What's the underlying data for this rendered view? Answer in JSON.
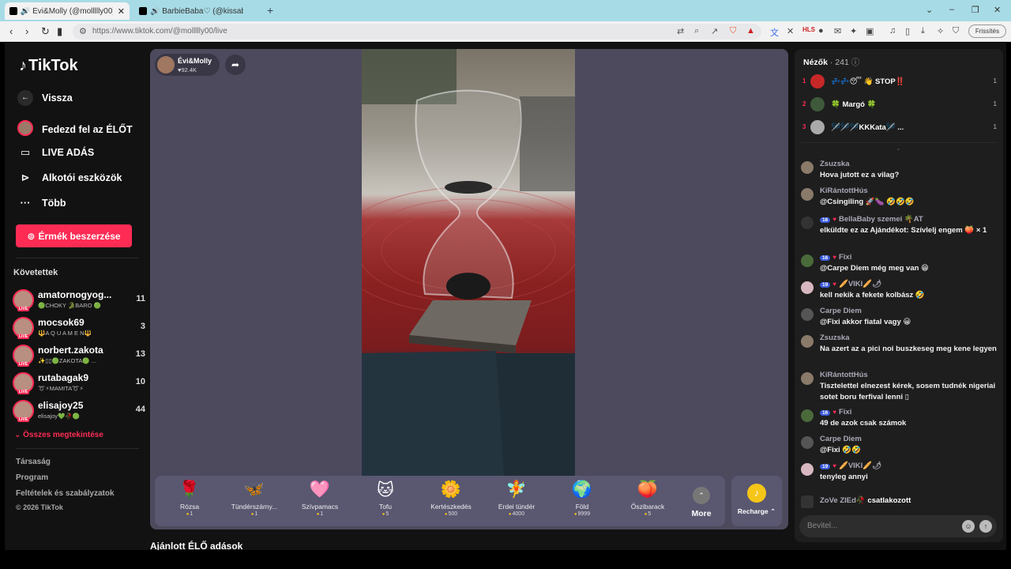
{
  "browser": {
    "tabs": [
      {
        "title": "🔊 Évi&Molly (@mollllly00) ÉLŐ"
      },
      {
        "title": "🔊 BarbieBaba♡ (@kissabarbie) ÉLŐ"
      }
    ],
    "new_tab": "+",
    "url": "https://www.tiktok.com/@mollllly00/live",
    "refresh_label": "Frissítés",
    "nav": {
      "back": "‹",
      "forward": "›",
      "reload": "↻"
    },
    "window": {
      "chevron": "⌄",
      "minimize": "–",
      "restore": "❐",
      "close": "✕"
    }
  },
  "sidebar": {
    "logo": "TikTok",
    "back": "Vissza",
    "nav": [
      {
        "label": "Fedezd fel az ÉLŐT",
        "icon": "avatar"
      },
      {
        "label": "LIVE ADÁS",
        "icon": "video-icon"
      },
      {
        "label": "Alkotói eszközök",
        "icon": "creator-icon"
      },
      {
        "label": "Több",
        "icon": "more-icon"
      }
    ],
    "coins_button": "Érmék beszerzése",
    "following_title": "Követettek",
    "following": [
      {
        "name": "amatornogyog...",
        "sub": "🟢CHOKY 🐊BARO 🟢",
        "count": "11"
      },
      {
        "name": "mocsok69",
        "sub": "🔱A Q U A M E N🔱",
        "count": "3"
      },
      {
        "name": "norbert.zakota",
        "sub": "✨▯▯🟢ZAKOTA🟢 ...",
        "count": "13"
      },
      {
        "name": "rutabagak9",
        "sub": "➰⚡MAMITA➰⚡",
        "count": "10"
      },
      {
        "name": "elisajoy25",
        "sub": "elisajoy💚🥀🟢",
        "count": "44"
      }
    ],
    "live_badge": "LIVE",
    "see_all": "Összes megtekintése",
    "footer": [
      "Társaság",
      "Program",
      "Feltételek és szabályzatok",
      "© 2026 TikTok"
    ]
  },
  "stream": {
    "host_name": "Évi&Molly",
    "host_likes": "♥92.4K",
    "gifts": [
      {
        "name": "Rózsa",
        "price": "1",
        "icon": "🌹"
      },
      {
        "name": "Tündérszárny...",
        "price": "1",
        "icon": "🦋"
      },
      {
        "name": "Szívpamacs",
        "price": "1",
        "icon": "🩷"
      },
      {
        "name": "Tofu",
        "price": "5",
        "icon": "🐱"
      },
      {
        "name": "Kertészkedés",
        "price": "500",
        "icon": "🌼"
      },
      {
        "name": "Erdei tündér",
        "price": "4000",
        "icon": "🧚"
      },
      {
        "name": "Föld",
        "price": "9999",
        "icon": "🌍"
      },
      {
        "name": "Őszibarack",
        "price": "5",
        "icon": "🍑"
      }
    ],
    "more": "More",
    "more_icon": "⌃",
    "recharge": "Recharge ⌃",
    "recommended_title": "Ajánlott ÉLŐ adások"
  },
  "chat": {
    "viewers_label": "Nézők",
    "viewers_count": "· 241",
    "top_viewers": [
      {
        "rank": "1",
        "name": "💤💤😴 👋 STOP‼️",
        "points": "1"
      },
      {
        "rank": "2",
        "name": "🍀 Margó 🍀",
        "points": "1"
      },
      {
        "rank": "3",
        "name": "🪡🪡🪡KKKata🪡 ...",
        "points": "1"
      }
    ],
    "messages": [
      {
        "user": "Zsuzska",
        "badge": "",
        "text": "Hova jutott ez a vilag?"
      },
      {
        "user": "KiRántottHús",
        "badge": "",
        "text": "@Csingiling 🚀🍆 🤣🤣🤣"
      },
      {
        "user": "BellaBaby szemei 🌴AT",
        "badge": "16",
        "text": "elküldte ez az Ajándékot: Szívlelj engem 🍑 × 1"
      },
      {
        "user": "Fixi",
        "badge": "16",
        "text": "@Carpe Diem még meg van 😁"
      },
      {
        "user": "🥖VIKI🥖🌶",
        "badge": "19",
        "text": "kell nekik a fekete kolbász 🤣"
      },
      {
        "user": "Carpe Diem",
        "badge": "",
        "text": "@Fixi akkor fiatal vagy 😀"
      },
      {
        "user": "Zsuzska",
        "badge": "",
        "text": "Na azert az a pici noi buszkeseg meg kene legyen"
      },
      {
        "user": "KiRántottHús",
        "badge": "",
        "text": "Tisztelettel elnezest kérek, sosem tudnék nigeriai sotet boru ferfival lenni ▯"
      },
      {
        "user": "Fixi",
        "badge": "16",
        "text": "49 de azok csak számok"
      },
      {
        "user": "Carpe Diem",
        "badge": "",
        "text": "@Fixi 🤣🤣"
      },
      {
        "user": "🥖VIKI🥖🌶",
        "badge": "19",
        "text": "tenyleg annyi"
      }
    ],
    "joined_user": "ZoVe ZIEd🥀",
    "joined_text": "csatlakozott",
    "input_placeholder": "Bevitel..."
  }
}
